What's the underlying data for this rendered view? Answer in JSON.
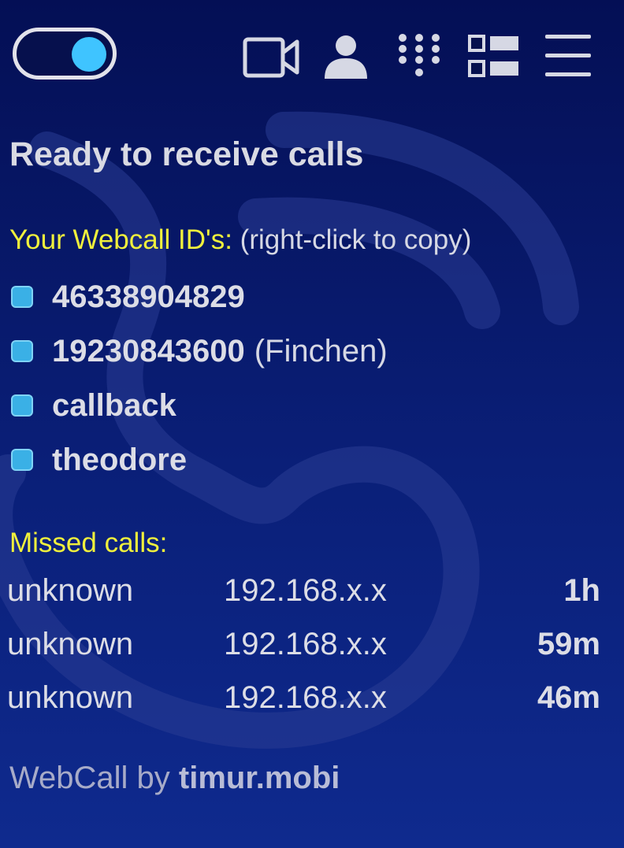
{
  "header": {
    "toggle_state": "on",
    "icons": [
      "video-camera-icon",
      "contacts-icon",
      "dialpad-icon",
      "layout-icon",
      "menu-icon"
    ]
  },
  "status": {
    "title": "Ready to receive calls"
  },
  "webcall_ids": {
    "label": "Your Webcall ID's:",
    "hint": "(right-click to copy)",
    "items": [
      {
        "id": "46338904829",
        "note": ""
      },
      {
        "id": "19230843600",
        "note": "(Finchen)"
      },
      {
        "id": "callback",
        "note": ""
      },
      {
        "id": "theodore",
        "note": ""
      }
    ]
  },
  "missed_calls": {
    "label": "Missed calls:",
    "rows": [
      {
        "caller": "unknown",
        "address": "192.168.x.x",
        "ago": "1h"
      },
      {
        "caller": "unknown",
        "address": "192.168.x.x",
        "ago": "59m"
      },
      {
        "caller": "unknown",
        "address": "192.168.x.x",
        "ago": "46m"
      }
    ]
  },
  "footer": {
    "prefix": "WebCall by",
    "brand": "timur.mobi"
  },
  "colors": {
    "accent": "#3fc4ff",
    "heading_yellow": "#f0f03c",
    "background_top": "#040f55",
    "background_bottom": "#0f2a8e"
  }
}
